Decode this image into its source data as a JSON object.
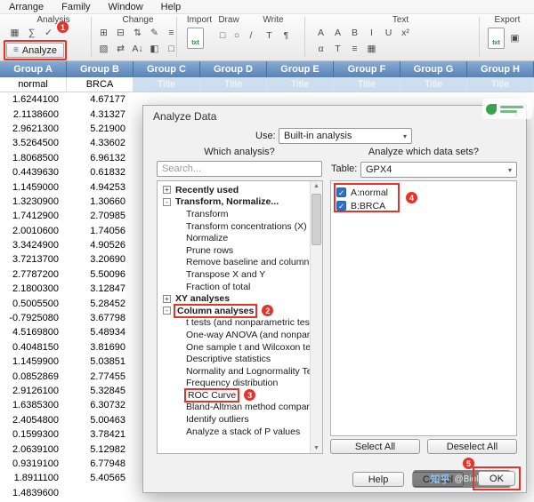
{
  "icons": {
    "check": "✓",
    "caret": "▾",
    "close": "×",
    "scroll_up": "▲",
    "scroll_down": "▼",
    "analyze": "≡",
    "picture": "▣"
  },
  "menu": {
    "items": [
      "Arrange",
      "Family",
      "Window",
      "Help"
    ]
  },
  "toolbar": {
    "section_labels": [
      "Analysis",
      "Change",
      "Import",
      "Draw",
      "Write",
      "Text",
      "Export"
    ],
    "analysis_icons": [
      {
        "name": "data-table-icon",
        "glyph": "▦"
      },
      {
        "name": "stats-sigma-icon",
        "glyph": "∑"
      },
      {
        "name": "checkmark-icon",
        "glyph": "✓"
      }
    ],
    "analyze_button": {
      "label": "Analyze"
    },
    "change_icons_row1": [
      {
        "name": "insert-column-icon",
        "glyph": "⊞"
      },
      {
        "name": "delete-column-icon",
        "glyph": "⊟"
      },
      {
        "name": "sort-icon",
        "glyph": "⇅"
      },
      {
        "name": "edit-values-icon",
        "glyph": "✎"
      },
      {
        "name": "format-icon",
        "glyph": "≡"
      }
    ],
    "change_icons_row2": [
      {
        "name": "transpose-icon",
        "glyph": "▧"
      },
      {
        "name": "swap-columns-icon",
        "glyph": "⇄"
      },
      {
        "name": "sort-az-icon",
        "glyph": "A↓"
      },
      {
        "name": "paint-icon",
        "glyph": "◧"
      },
      {
        "name": "clear-format-icon",
        "glyph": "□"
      }
    ],
    "import_icon_label": "txt",
    "draw_icons": [
      {
        "name": "rectangle-tool-icon",
        "glyph": "□"
      },
      {
        "name": "oval-tool-icon",
        "glyph": "○"
      },
      {
        "name": "line-tool-icon",
        "glyph": "/"
      }
    ],
    "write_icons": [
      {
        "name": "text-box-icon",
        "glyph": "T"
      },
      {
        "name": "paragraph-icon",
        "glyph": "¶"
      }
    ],
    "text_icons_row1": [
      {
        "name": "increase-font-icon",
        "glyph": "A"
      },
      {
        "name": "decrease-font-icon",
        "glyph": "A"
      },
      {
        "name": "bold-icon",
        "glyph": "B"
      },
      {
        "name": "italic-icon",
        "glyph": "I"
      },
      {
        "name": "underline-icon",
        "glyph": "U"
      },
      {
        "name": "superscript-icon",
        "glyph": "x²"
      }
    ],
    "text_icons_row2": [
      {
        "name": "greek-icon",
        "glyph": "α"
      },
      {
        "name": "text-color-icon",
        "glyph": "T"
      },
      {
        "name": "align-icon",
        "glyph": "≡"
      },
      {
        "name": "table-format-icon",
        "glyph": "▦"
      }
    ],
    "export_icon_label": "txt"
  },
  "annotations": [
    "1",
    "2",
    "3",
    "4",
    "5"
  ],
  "table": {
    "columns": [
      {
        "group": "Group A",
        "title": "normal",
        "placeholder": false
      },
      {
        "group": "Group B",
        "title": "BRCA",
        "placeholder": false
      },
      {
        "group": "Group C",
        "title": "Title",
        "placeholder": true
      },
      {
        "group": "Group D",
        "title": "Title",
        "placeholder": true
      },
      {
        "group": "Group E",
        "title": "Title",
        "placeholder": true
      },
      {
        "group": "Group F",
        "title": "Title",
        "placeholder": true
      },
      {
        "group": "Group G",
        "title": "Title",
        "placeholder": true
      },
      {
        "group": "Group H",
        "title": "Title",
        "placeholder": true
      }
    ],
    "rows": [
      [
        "1.6244100",
        "4.67177"
      ],
      [
        "2.1138600",
        "4.31327"
      ],
      [
        "2.9621300",
        "5.21900"
      ],
      [
        "3.5264500",
        "4.33602"
      ],
      [
        "1.8068500",
        "6.96132"
      ],
      [
        "0.4439630",
        "0.61832"
      ],
      [
        "1.1459000",
        "4.94253"
      ],
      [
        "1.3230900",
        "1.30660"
      ],
      [
        "1.7412900",
        "2.70985"
      ],
      [
        "2.0010600",
        "1.74056"
      ],
      [
        "3.3424900",
        "4.90526"
      ],
      [
        "3.7213700",
        "3.20690"
      ],
      [
        "2.7787200",
        "5.50096"
      ],
      [
        "2.1800300",
        "3.12847"
      ],
      [
        "0.5005500",
        "5.28452"
      ],
      [
        "-0.7925080",
        "3.67798"
      ],
      [
        "4.5169800",
        "5.48934"
      ],
      [
        "0.4048150",
        "3.81690"
      ],
      [
        "1.1459900",
        "5.03851"
      ],
      [
        "0.0852869",
        "2.77455"
      ],
      [
        "2.9126100",
        "5.32845"
      ],
      [
        "1.6385300",
        "6.30732"
      ],
      [
        "2.4054800",
        "5.00463"
      ],
      [
        "0.1599300",
        "3.78421"
      ],
      [
        "2.0639100",
        "5.12982"
      ],
      [
        "0.9319100",
        "6.77948"
      ],
      [
        "1.8911100",
        "5.40565"
      ],
      [
        "1.4839600",
        ""
      ]
    ]
  },
  "dialog": {
    "title": "Analyze Data",
    "use_label": "Use:",
    "use_value": "Built-in analysis",
    "which_analysis_label": "Which analysis?",
    "search_placeholder": "Search...",
    "datasets_label": "Analyze which data sets?",
    "table_label": "Table:",
    "table_value": "GPX4",
    "tree": [
      {
        "label": "Recently used",
        "level": 0,
        "exp": "plus",
        "bold": true
      },
      {
        "label": "Transform, Normalize...",
        "level": 0,
        "exp": "minus",
        "bold": true
      },
      {
        "label": "Transform",
        "level": 1
      },
      {
        "label": "Transform concentrations (X)",
        "level": 1
      },
      {
        "label": "Normalize",
        "level": 1
      },
      {
        "label": "Prune rows",
        "level": 1
      },
      {
        "label": "Remove baseline and column math",
        "level": 1
      },
      {
        "label": "Transpose X and Y",
        "level": 1
      },
      {
        "label": "Fraction of total",
        "level": 1
      },
      {
        "label": "XY analyses",
        "level": 0,
        "exp": "plus",
        "bold": true
      },
      {
        "label": "Column analyses",
        "level": 0,
        "exp": "minus",
        "bold": true,
        "step": "2"
      },
      {
        "label": "t tests (and nonparametric tests)",
        "level": 1
      },
      {
        "label": "One-way ANOVA (and nonparametric or",
        "level": 1
      },
      {
        "label": "One sample t and Wilcoxon test",
        "level": 1
      },
      {
        "label": "Descriptive statistics",
        "level": 1
      },
      {
        "label": "Normality and Lognormality Tests",
        "level": 1
      },
      {
        "label": "Frequency distribution",
        "level": 1
      },
      {
        "label": "ROC Curve",
        "level": 1,
        "step": "3"
      },
      {
        "label": "Bland-Altman method comparison",
        "level": 1
      },
      {
        "label": "Identify outliers",
        "level": 1
      },
      {
        "label": "Analyze a stack of P values",
        "level": 1
      }
    ],
    "datasets": [
      {
        "label": "A:normal",
        "checked": true
      },
      {
        "label": "B:BRCA",
        "checked": true
      }
    ],
    "select_all": "Select All",
    "deselect_all": "Deselect All",
    "help": "Help",
    "cancel": "Cancel",
    "ok": "OK"
  },
  "watermarks": {
    "zhihu": "知乎",
    "author": "@BioMan"
  }
}
